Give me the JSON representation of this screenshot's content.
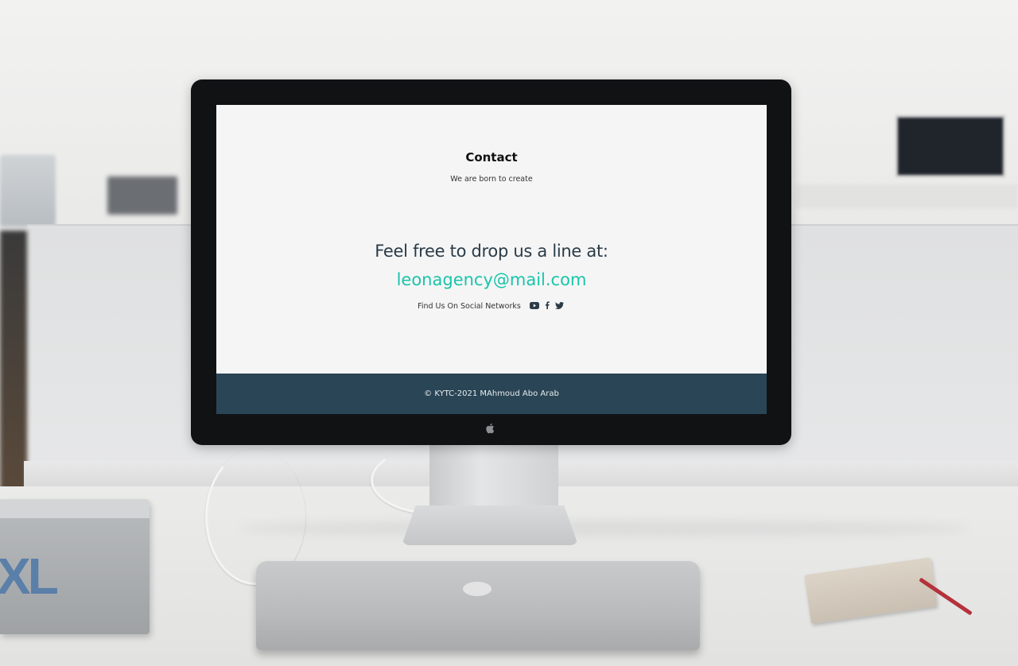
{
  "page": {
    "section_title": "Contact",
    "section_subtitle": "We are born to create",
    "headline": "Feel free to drop us a line at:",
    "email": "leonagency@mail.com",
    "social_label": "Find Us On Social Networks",
    "social_icons": [
      "youtube-icon",
      "facebook-icon",
      "twitter-icon"
    ],
    "footer_text": "© KYTC-2021 MAhmoud Abo Arab"
  },
  "book": {
    "cover_text": "XL"
  },
  "colors": {
    "accent": "#19c5a9",
    "headline": "#2a3b47",
    "footer_bg": "#2a4555",
    "screen_bg": "#f5f5f6"
  }
}
